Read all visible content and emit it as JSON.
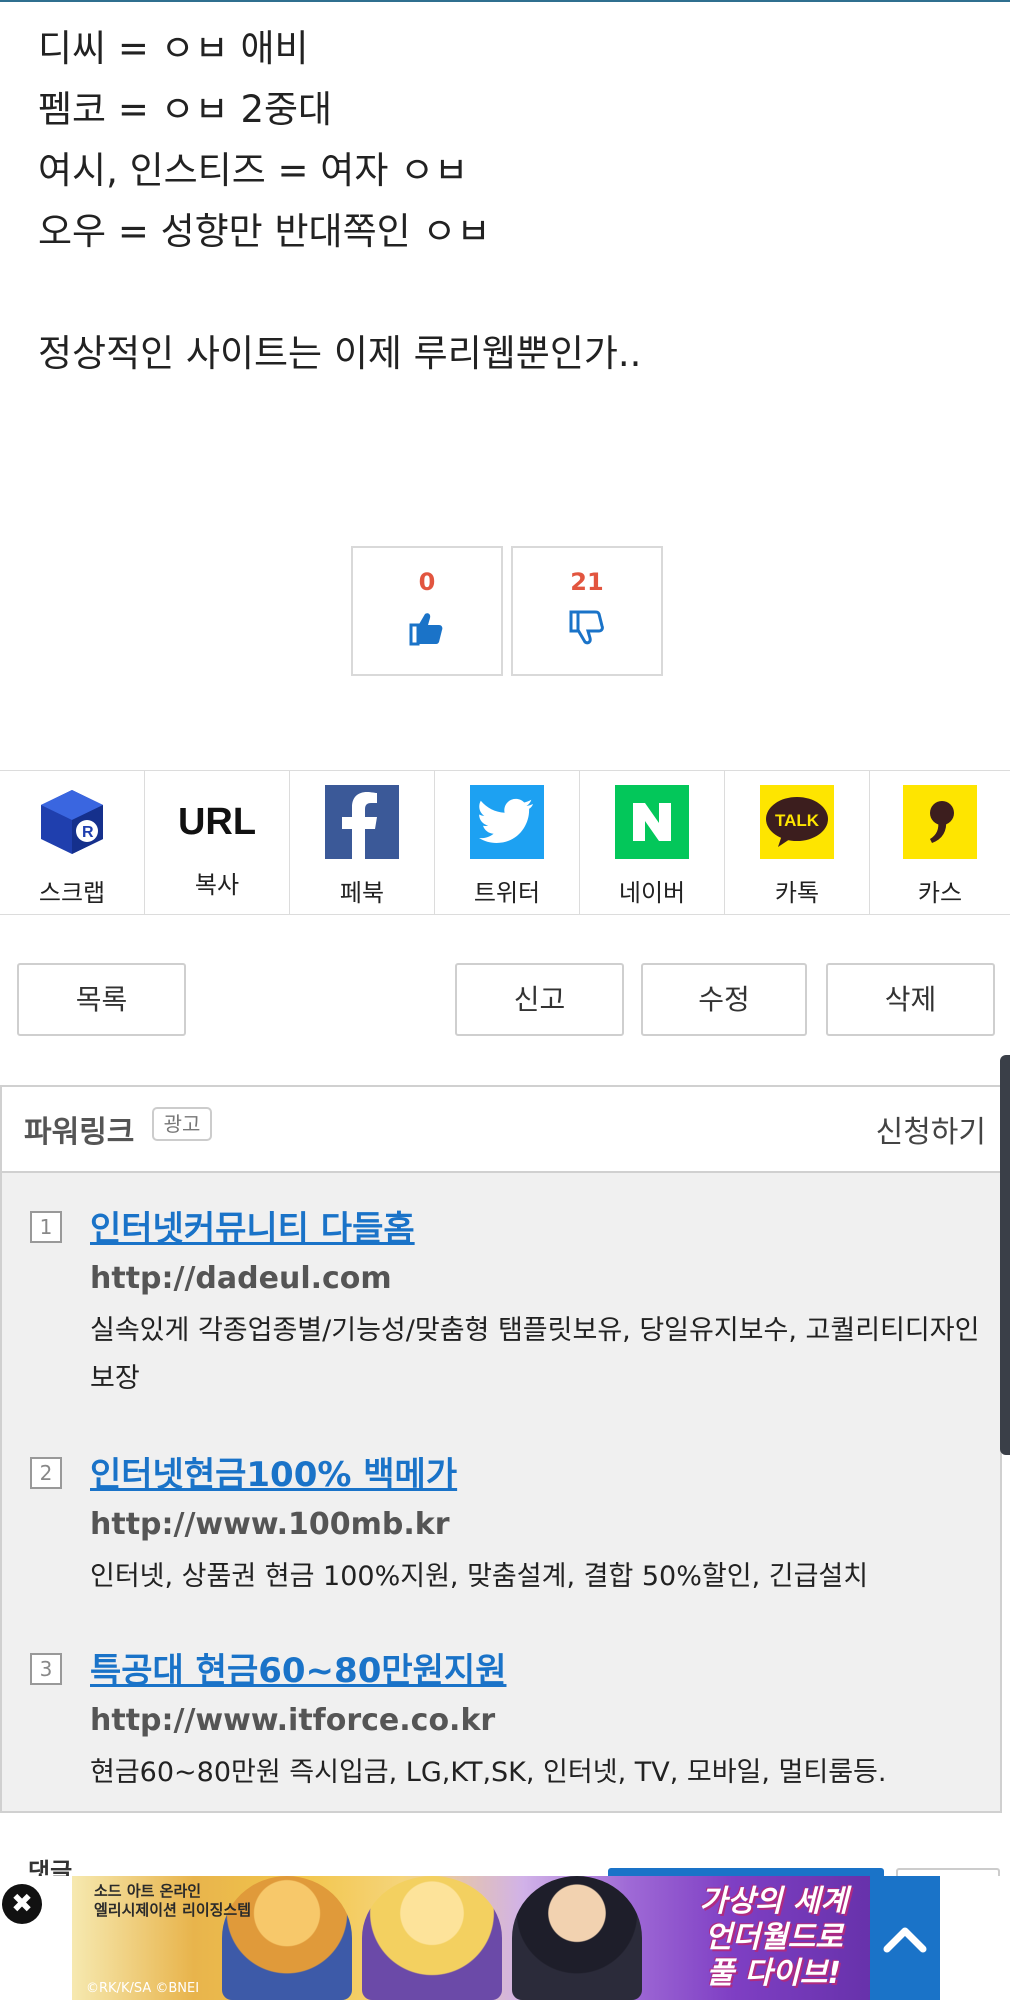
{
  "post": {
    "lines": [
      "디씨 = ㅇㅂ 애비",
      "펨코 = ㅇㅂ 2중대",
      "여시, 인스티즈 = 여자 ㅇㅂ",
      "오우 = 성향만 반대쪽인 ㅇㅂ",
      "",
      "정상적인 사이트는 이제 루리웹뿐인가.."
    ]
  },
  "votes": {
    "up_count": "0",
    "down_count": "21",
    "count_color": "#e2553f",
    "icon_color": "#1a73c8"
  },
  "share": [
    {
      "label": "스크랩",
      "icon": "scrap-cube-icon",
      "color": "#1f3fae"
    },
    {
      "label": "복사",
      "icon_text": "URL"
    },
    {
      "label": "페북",
      "icon": "facebook-icon",
      "color": "#3b5998"
    },
    {
      "label": "트위터",
      "icon": "twitter-icon",
      "color": "#1da1f2"
    },
    {
      "label": "네이버",
      "icon": "naver-icon",
      "color": "#03c75a"
    },
    {
      "label": "카톡",
      "icon": "kakaotalk-icon",
      "icon_text": "TALK",
      "color": "#fee500"
    },
    {
      "label": "카스",
      "icon": "kakaostory-icon",
      "color": "#fee500"
    }
  ],
  "actions": {
    "list": "목록",
    "report": "신고",
    "edit": "수정",
    "delete": "삭제"
  },
  "powerlink": {
    "title": "파워링크",
    "tag": "광고",
    "apply": "신청하기",
    "ads": [
      {
        "num": "1",
        "title": "인터넷커뮤니티 다들홈",
        "url": "http://dadeul.com",
        "desc": "실속있게 각종업종별/기능성/맞춤형 탬플릿보유, 당일유지보수, 고퀄리티디자인보장"
      },
      {
        "num": "2",
        "title": "인터넷현금100% 백메가",
        "url": "http://www.100mb.kr",
        "desc": "인터넷, 상품권 현금 100%지원, 맞춤설계, 결합 50%할인, 긴급설치"
      },
      {
        "num": "3",
        "title": "특공대 현금60~80만원지원",
        "url": "http://www.itforce.co.kr",
        "desc": "현금60~80만원 즉시입금, LG,KT,SK, 인터넷, TV, 모바일, 멀티룸등."
      }
    ],
    "link_color": "#1a73c8"
  },
  "bottom_peek": {
    "text": "댓글"
  },
  "banner": {
    "logo_line1": "소드 아트 온라인",
    "logo_line2": "엘리시제이션 리이징스텝",
    "credit": "©RK/K/SA ©BNEI",
    "tag_line1": "가상의 세계",
    "tag_line2": "언더월드로",
    "tag_line3": "풀 다이브!",
    "close_glyph": "✖"
  }
}
